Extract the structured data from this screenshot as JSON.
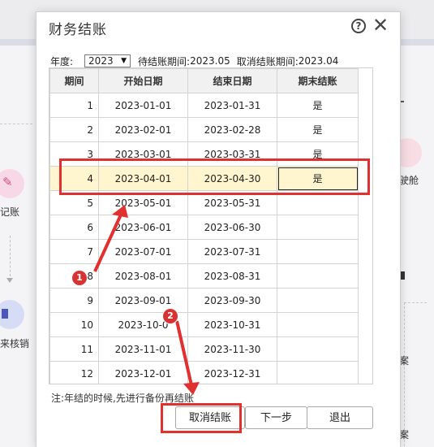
{
  "background": {
    "left_items": [
      "记账",
      "来核销"
    ],
    "right_items": [
      "驶舱",
      "案",
      "案"
    ]
  },
  "dialog": {
    "title": "财务结账",
    "help_icon": "help-circle-icon",
    "close_icon": "close-x-icon",
    "year_label": "年度:",
    "year_value": "2023",
    "pending_label": "待结账期间:",
    "pending_value": "2023.05",
    "cancel_label": "取消结账期间:",
    "cancel_value": "2023.04",
    "table": {
      "headers": [
        "期间",
        "开始日期",
        "结束日期",
        "期末结账"
      ],
      "rows": [
        {
          "period": "1",
          "start": "2023-01-01",
          "end": "2023-01-31",
          "closed": "是"
        },
        {
          "period": "2",
          "start": "2023-02-01",
          "end": "2023-02-28",
          "closed": "是"
        },
        {
          "period": "3",
          "start": "2023-03-01",
          "end": "2023-03-31",
          "closed": "是"
        },
        {
          "period": "4",
          "start": "2023-04-01",
          "end": "2023-04-30",
          "closed": "是"
        },
        {
          "period": "5",
          "start": "2023-05-01",
          "end": "2023-05-31",
          "closed": ""
        },
        {
          "period": "6",
          "start": "2023-06-01",
          "end": "2023-06-30",
          "closed": ""
        },
        {
          "period": "7",
          "start": "2023-07-01",
          "end": "2023-07-31",
          "closed": ""
        },
        {
          "period": "8",
          "start": "2023-08-01",
          "end": "2023-08-31",
          "closed": ""
        },
        {
          "period": "9",
          "start": "2023-09-01",
          "end": "2023-09-30",
          "closed": ""
        },
        {
          "period": "10",
          "start": "2023-10-0",
          "end": "2023-10-31",
          "closed": ""
        },
        {
          "period": "11",
          "start": "2023-11-01",
          "end": "2023-11-30",
          "closed": ""
        },
        {
          "period": "12",
          "start": "2023-12-01",
          "end": "2023-12-31",
          "closed": ""
        }
      ]
    },
    "note": "注:年结的时候,先进行备份再结账",
    "buttons": {
      "cancel": "取消结账",
      "next": "下一步",
      "exit": "退出"
    }
  },
  "annotations": {
    "badge1": "1",
    "badge2": "2",
    "color": "#e03030"
  }
}
